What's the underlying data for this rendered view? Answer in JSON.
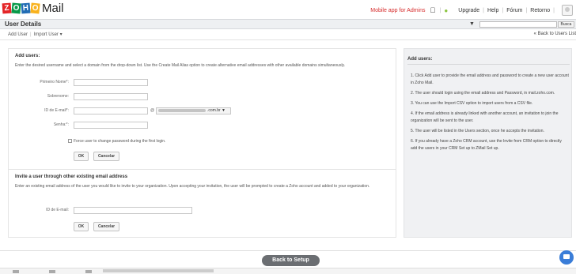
{
  "brand": {
    "logo_letters": [
      "Z",
      "O",
      "H",
      "O"
    ],
    "product": "Mail"
  },
  "topnav": {
    "mobile_link": "Mobile app for Admins",
    "upgrade": "Upgrade",
    "help": "Help",
    "forum": "Fórum",
    "retorno": "Retorno",
    "icons": [
      "apple-icon",
      "android-icon",
      "avatar"
    ]
  },
  "header": {
    "title": "User Details",
    "search_button": "Busca",
    "search_placeholder": ""
  },
  "subnav": {
    "add_user": "Add User",
    "import_user": "Import User ▾",
    "back": "« Back to Users List"
  },
  "add_users": {
    "title": "Add users:",
    "description": "Enter the desired username and select a domain from the drop-down list. Use the Create Mail Alias option to create alternative email addresses with other available domains simultaneously.",
    "first_name_label": "Primeiro Nome*:",
    "last_name_label": "Sobrenome:",
    "email_label": "ID de E-mail*:",
    "at_sign": "@",
    "domain_suffix": ".com.br ▼",
    "password_label": "Senha:*:",
    "force_change_label": "Force user to change password during the first login.",
    "ok": "OK",
    "cancel": "Cancelar"
  },
  "invite": {
    "title": "Invite a user through other existing email address",
    "description": "Enter an existing email address of the user you would like to invite to your organization. Upon accepting your invitation, the user will be prompted to create a Zoho account and added to your organization.",
    "email_label": "ID de E-mail:",
    "ok": "OK",
    "cancel": "Cancelar"
  },
  "help": {
    "title": "Add users:",
    "items": [
      "1. Click Add user to provide the email address and password to create a new user account in Zoho Mail.",
      "2. The user should login using the email address and Password, in mail.zoho.com.",
      "3. You can use the Import CSV option to import users from a CSV file.",
      "4. If the email address is already linked with another account, an invitation to join the organization will be sent to the user.",
      "5. The user will be listed in the Users section, once he accepts the invitation.",
      "6. If you already have a Zoho CRM account, use the Invite from CRM option to directly add the users in your CRM Set up to ZMail Set up."
    ]
  },
  "footer": {
    "back_to_setup": "Back to Setup"
  },
  "colors": {
    "accent": "#d62b2b",
    "help_bg": "#f0f1f3",
    "setup_button": "#6b6e72",
    "chat": "#3a7dd8"
  }
}
